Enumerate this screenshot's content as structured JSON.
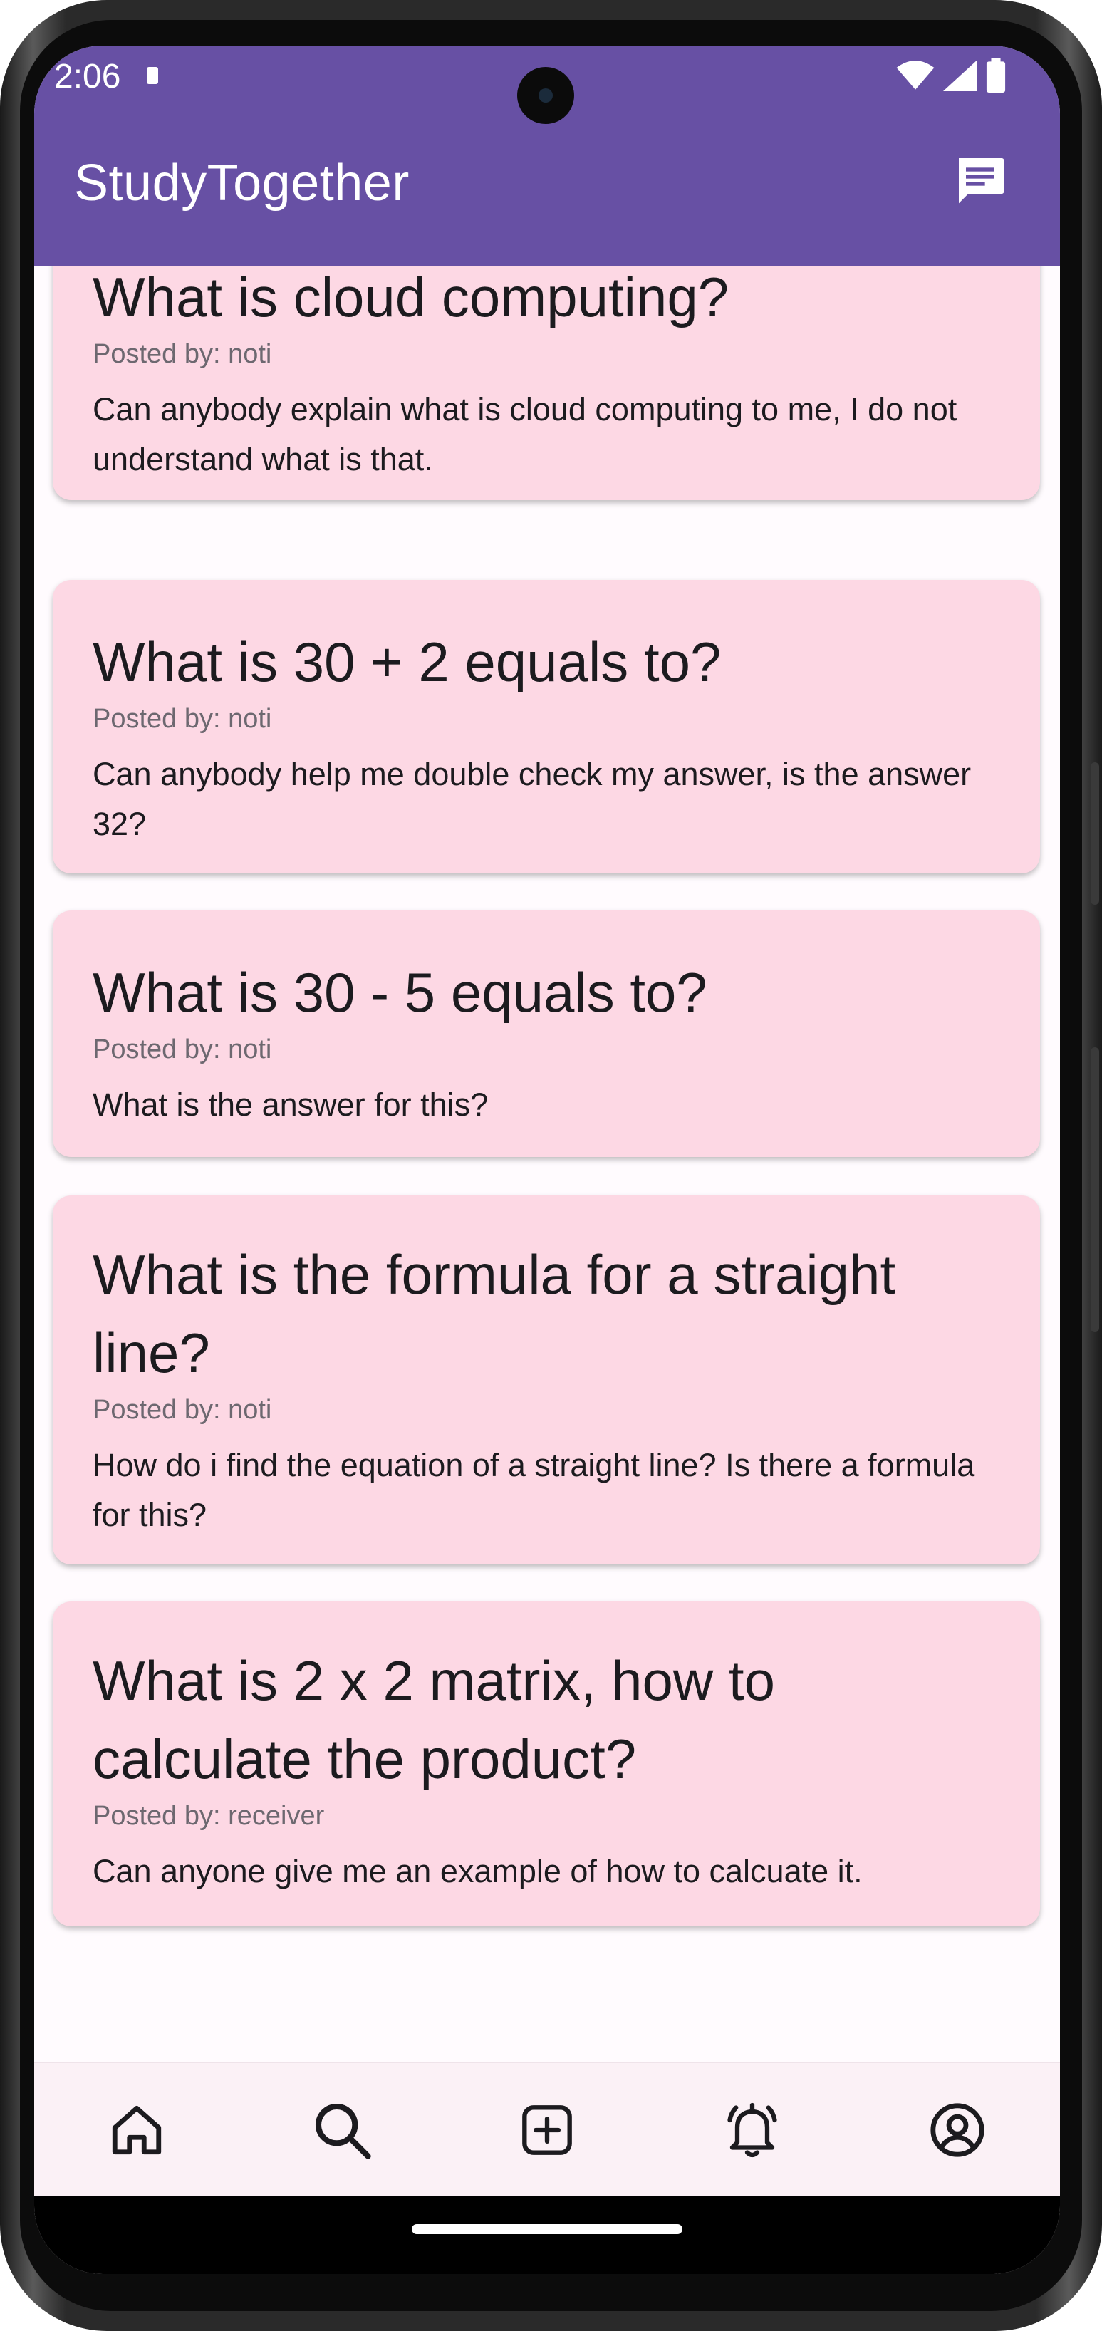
{
  "status_bar": {
    "time": "2:06"
  },
  "app_bar": {
    "title": "StudyTogether"
  },
  "icons": {
    "chat": "chat-icon",
    "home": "home-icon",
    "search": "search-icon",
    "add": "add-box-icon",
    "notifications": "bell-icon",
    "profile": "account-circle-icon"
  },
  "colors": {
    "primary": "#6750a4",
    "card": "#fdd8e4",
    "background": "#fffbfe",
    "nav": "#fbf1f6"
  },
  "posts": [
    {
      "title": "What is cloud computing?",
      "author": "Posted by: noti",
      "body": "Can anybody explain what is cloud computing to me, I do not understand what is that."
    },
    {
      "title": "What is 30 + 2 equals to?",
      "author": "Posted by: noti",
      "body": "Can anybody help me double check my answer, is the answer 32?"
    },
    {
      "title": "What is 30 - 5 equals to?",
      "author": "Posted by: noti",
      "body": "What is the answer for this?"
    },
    {
      "title": "What is the formula for a straight line?",
      "author": "Posted by: noti",
      "body": "How do i find the equation of a straight line? Is there a formula for this?"
    },
    {
      "title": "What is 2 x 2 matrix, how to calculate the product?",
      "author": "Posted by: receiver",
      "body": "Can anyone give me an example of how to calcuate it."
    }
  ]
}
